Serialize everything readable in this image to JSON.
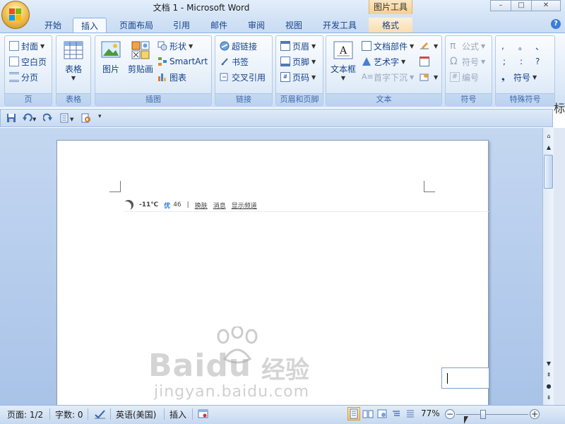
{
  "window": {
    "title": "文档 1 - Microsoft Word",
    "context_group": "图片工具",
    "minimize": "–",
    "restore": "□",
    "close": "✕",
    "help": "?"
  },
  "tabs": [
    "开始",
    "插入",
    "页面布局",
    "引用",
    "邮件",
    "审阅",
    "视图",
    "开发工具",
    "格式"
  ],
  "active_tab": "插入",
  "ribbon": {
    "pages": {
      "label": "页",
      "cover": "封面",
      "blank": "空白页",
      "break": "分页"
    },
    "tables": {
      "label": "表格",
      "table": "表格"
    },
    "illustrations": {
      "label": "插图",
      "picture": "图片",
      "clipart": "剪贴画",
      "shapes": "形状",
      "smartart": "SmartArt",
      "chart": "图表"
    },
    "links": {
      "label": "链接",
      "hyperlink": "超链接",
      "bookmark": "书签",
      "crossref": "交叉引用"
    },
    "header_footer": {
      "label": "页眉和页脚",
      "header": "页眉",
      "footer": "页脚",
      "page_number": "页码"
    },
    "text": {
      "label": "文本",
      "textbox": "文本框",
      "quickparts": "文档部件",
      "wordart": "艺术字",
      "dropcap": "首字下沉"
    },
    "symbols": {
      "label": "符号",
      "equation": "公式",
      "symbol": "符号",
      "number": "编号"
    },
    "special": {
      "label": "特殊符号",
      "chars": [
        ",",
        "。",
        "、",
        ";",
        ":",
        "?"
      ],
      "symbol": "符号"
    }
  },
  "document": {
    "weather": {
      "temp": "-11℃",
      "quality": "优",
      "aqi": "46",
      "sep": "|",
      "skin": "换肤",
      "news": "消息",
      "show_channel": "显示频道"
    }
  },
  "watermark": {
    "brand": "Bai",
    "brand2": "du",
    "jingyan": "经验",
    "url": "jingyan.baidu.com"
  },
  "statusbar": {
    "page": "页面: 1/2",
    "words": "字数: 0",
    "language": "英语(美国)",
    "insert": "插入",
    "zoom": "77%",
    "zoom_level": 0.77
  },
  "side_text": "标"
}
